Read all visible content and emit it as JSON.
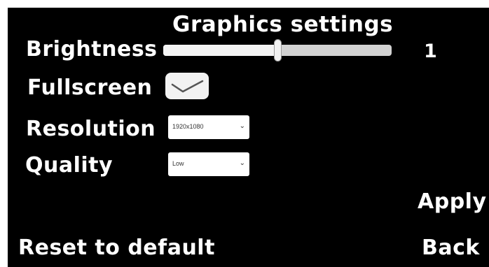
{
  "title": "Graphics settings",
  "brightness": {
    "label": "Brightness",
    "value_text": "1",
    "slider_fraction": 0.5
  },
  "fullscreen": {
    "label": "Fullscreen",
    "checked": true
  },
  "resolution": {
    "label": "Resolution",
    "selected": "1920x1080",
    "arrow": "⌄"
  },
  "quality": {
    "label": "Quality",
    "selected": "Low",
    "arrow": "⌄"
  },
  "buttons": {
    "apply": "Apply",
    "reset": "Reset to default",
    "back": "Back"
  },
  "colors": {
    "background": "#000000",
    "text": "#ffffff",
    "control": "#f2f2f2"
  }
}
